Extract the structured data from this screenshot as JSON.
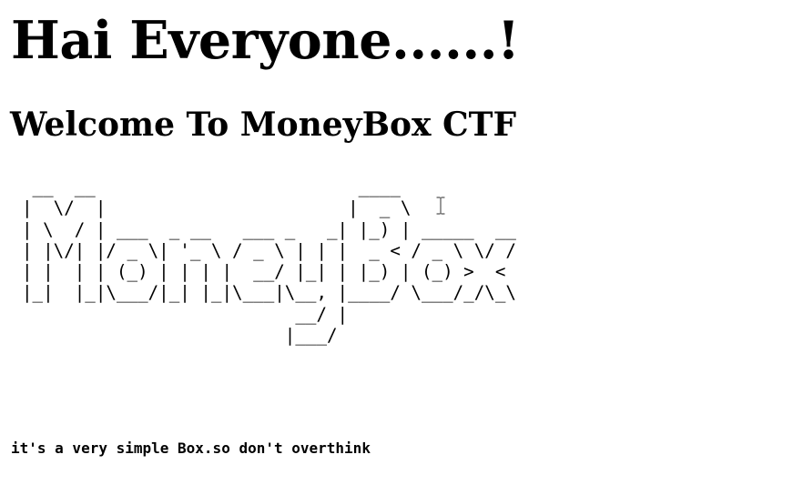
{
  "page": {
    "heading": "Hai Everyone......!",
    "subheading": "Welcome To MoneyBox CTF",
    "ascii_art": " __  __                         ____\n|  \\/  |                       |  _ \\\n| \\  / | ___  _ __   ___ _   _| |_) | _____  __\n| |\\/| |/ _ \\| '_ \\ / _ \\ | | |  _ < / _ \\ \\/ /\n| |  | | (_) | | | |  __/ |_| | |_) | (_) >  <\n|_|  |_|\\___/|_| |_|\\___|\\__, |____/ \\___/_/\\_\\\n                          __/ |\n                         |___/",
    "tagline": "it's a very simple Box.so don't overthink"
  },
  "cursor": {
    "icon": "text-cursor-icon"
  }
}
